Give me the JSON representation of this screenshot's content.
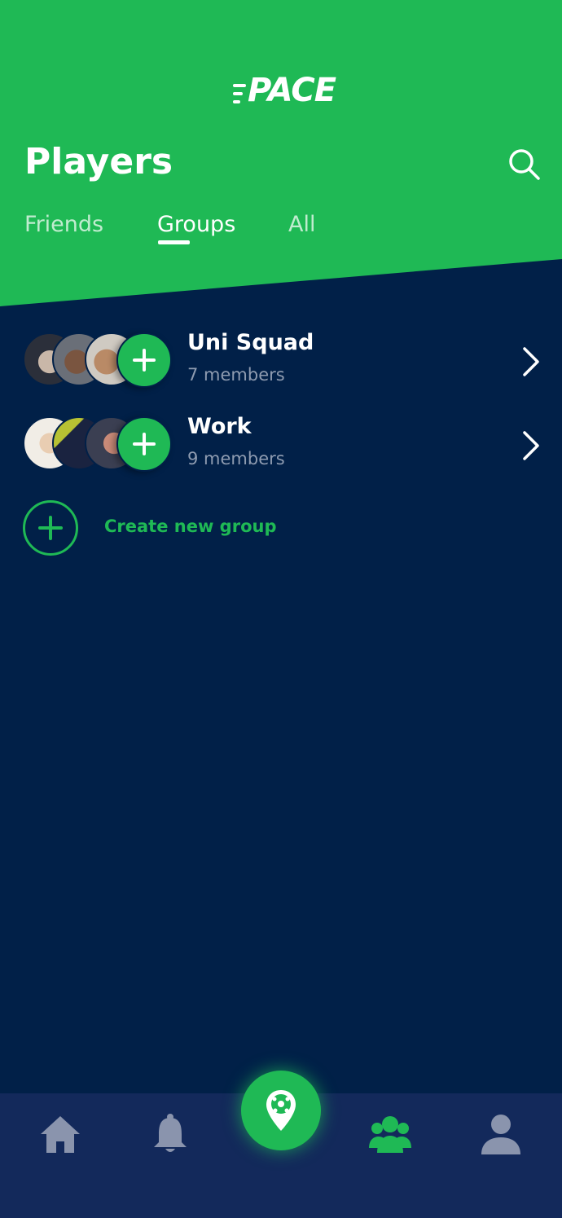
{
  "app": {
    "logo_text": "PACE"
  },
  "header": {
    "title": "Players"
  },
  "tabs": [
    {
      "label": "Friends",
      "active": false
    },
    {
      "label": "Groups",
      "active": true
    },
    {
      "label": "All",
      "active": false
    }
  ],
  "groups": [
    {
      "name": "Uni Squad",
      "members": "7 members"
    },
    {
      "name": "Work",
      "members": "9 members"
    }
  ],
  "create_group": {
    "label": "Create new group"
  },
  "bottom_nav": {
    "items": [
      {
        "icon": "home-icon",
        "active": false
      },
      {
        "icon": "bell-icon",
        "active": false
      },
      {
        "icon": "location-ball-icon",
        "active": true
      },
      {
        "icon": "group-icon",
        "active": true
      },
      {
        "icon": "person-icon",
        "active": false
      }
    ]
  },
  "colors": {
    "accent": "#1fb955",
    "background": "#012048",
    "nav_background": "#13295b",
    "inactive_icon": "#8a94ad",
    "secondary_text": "#8e9bb0"
  }
}
